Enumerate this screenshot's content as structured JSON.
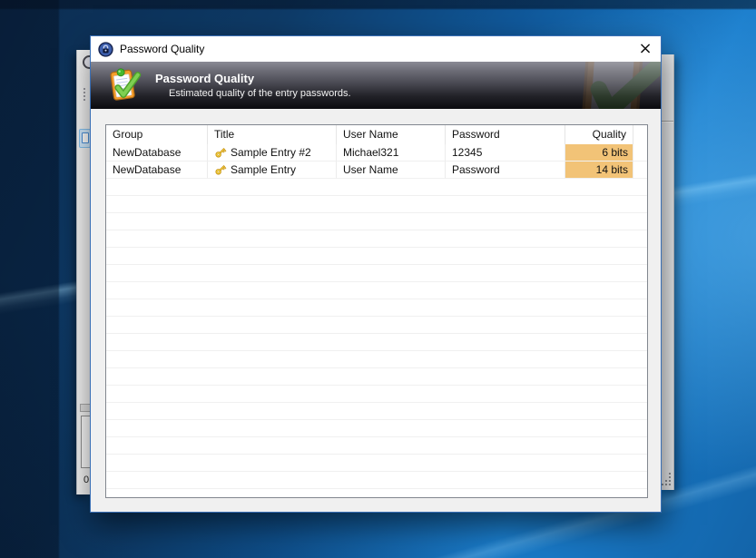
{
  "window": {
    "title": "Password Quality",
    "close_label": "×"
  },
  "banner": {
    "title": "Password Quality",
    "subtitle": "Estimated quality of the entry passwords."
  },
  "table": {
    "columns": {
      "group": "Group",
      "title": "Title",
      "user": "User Name",
      "password": "Password",
      "quality": "Quality"
    },
    "rows": [
      {
        "group": "NewDatabase",
        "title": "Sample Entry #2",
        "user": "Michael321",
        "password": "12345",
        "quality": "6 bits"
      },
      {
        "group": "NewDatabase",
        "title": "Sample Entry",
        "user": "User Name",
        "password": "Password",
        "quality": "14 bits"
      }
    ]
  },
  "background_window": {
    "status_value": "0"
  },
  "icons": {
    "titlebar": "keepass-lock-icon",
    "banner": "clipboard-check-icon",
    "row": "key-icon"
  },
  "colors": {
    "quality_highlight": "#F2C377",
    "banner_gradient_top": "#8A8A94",
    "banner_gradient_bottom": "#0A0A0E",
    "dialog_border": "#3A6FB5",
    "desktop_blue": "#1A7DCC",
    "titlebar_bg": "#FFFFFF",
    "grid_line": "#F0F0F0"
  }
}
